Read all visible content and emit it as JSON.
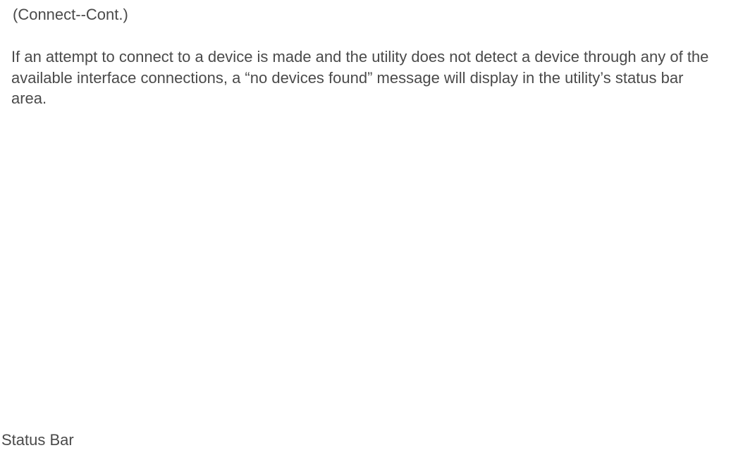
{
  "heading": "(Connect--Cont.)",
  "paragraph": "If an attempt to connect to a device is made and the utility does not detect a device through any of the available interface connections, a “no devices found” message will display in the utility’s status bar area.",
  "footer_label": "Status Bar"
}
